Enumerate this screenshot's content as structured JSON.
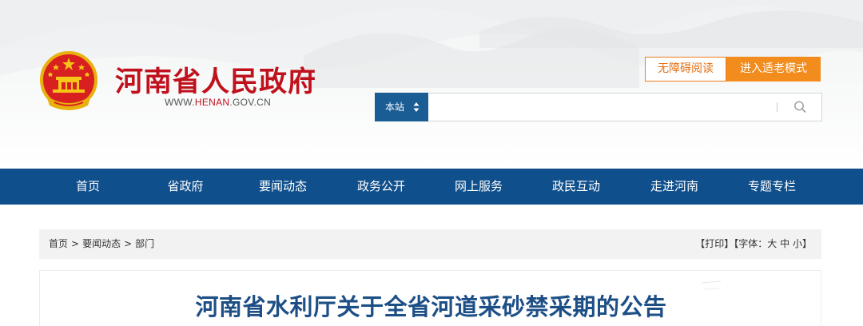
{
  "header": {
    "site_title": "河南省人民政府",
    "domain_prefix": "WWW.",
    "domain_highlight": "HENAN",
    "domain_suffix": ".GOV.CN",
    "accessibility_label": "无障碍阅读",
    "elder_mode_label": "进入适老模式",
    "search": {
      "scope_label": "本站",
      "placeholder": "",
      "value": ""
    }
  },
  "nav": {
    "items": [
      {
        "label": "首页"
      },
      {
        "label": "省政府"
      },
      {
        "label": "要闻动态"
      },
      {
        "label": "政务公开"
      },
      {
        "label": "网上服务"
      },
      {
        "label": "政民互动"
      },
      {
        "label": "走进河南"
      },
      {
        "label": "专题专栏"
      }
    ]
  },
  "breadcrumb": {
    "items": [
      {
        "label": "首页"
      },
      {
        "label": "要闻动态"
      },
      {
        "label": "部门"
      }
    ],
    "separator": ">"
  },
  "tools": {
    "print_label": "【打印】",
    "font_prefix": "【字体：",
    "font_large": "大",
    "font_medium": "中",
    "font_small": "小",
    "font_suffix": "】"
  },
  "article": {
    "title": "河南省水利厅关于全省河道采砂禁采期的公告"
  },
  "colors": {
    "brand_red": "#c0121d",
    "nav_blue": "#0f4f8c",
    "search_blue": "#1a5c94",
    "accent_orange": "#f28c1d",
    "title_blue": "#1d4f86"
  }
}
